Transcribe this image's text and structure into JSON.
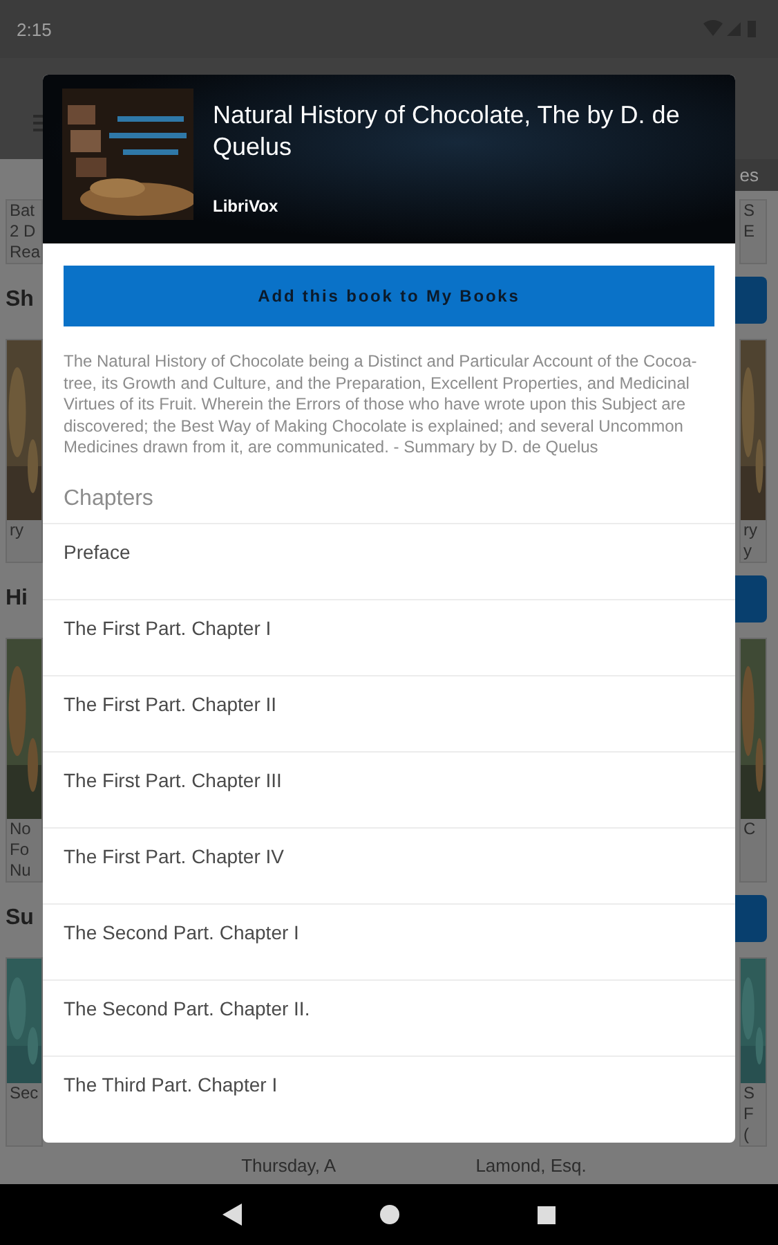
{
  "status_bar": {
    "time": "2:15"
  },
  "app_bar": {
    "chip": "es"
  },
  "background_sections": [
    {
      "left_card": [
        "Bat",
        "2 D",
        "Rea"
      ],
      "right_card": [
        "S",
        "E"
      ],
      "kind": "text"
    },
    {
      "heading": "Sh",
      "left_card": [
        "ry"
      ],
      "right_card": [
        "ry",
        "y"
      ],
      "kind": "picture"
    },
    {
      "heading": "Hi",
      "left_card": [
        "No",
        "Fo",
        "Nu"
      ],
      "right_card": [
        "C"
      ],
      "kind": "picture"
    },
    {
      "heading": "Su",
      "left_card": [
        "Sec"
      ],
      "right_card": [
        "S",
        "F",
        "("
      ],
      "kind": "picture"
    }
  ],
  "bottom_captions": [
    "Thursday, A",
    "Lamond, Esq."
  ],
  "dialog": {
    "title": "Natural History of Chocolate, The by D. de Quelus",
    "publisher": "LibriVox",
    "add_button": "Add this book to My Books",
    "description": "The Natural History of Chocolate being a Distinct and Particular Account of the Cocoa-tree, its Growth and Culture, and the Preparation, Excellent Properties, and Medicinal Virtues of its Fruit. Wherein the Errors of those who have wrote upon this Subject are discovered; the Best Way of Making Chocolate is explained; and several Uncommon Medicines drawn from it, are communicated. - Summary by D. de Quelus",
    "chapters_heading": "Chapters",
    "chapters": [
      "Preface",
      "The First Part. Chapter I",
      "The First Part. Chapter II",
      "The First Part. Chapter III",
      "The First Part. Chapter IV",
      "The Second Part. Chapter I",
      "The Second Part. Chapter II.",
      "The Third Part. Chapter I"
    ]
  }
}
